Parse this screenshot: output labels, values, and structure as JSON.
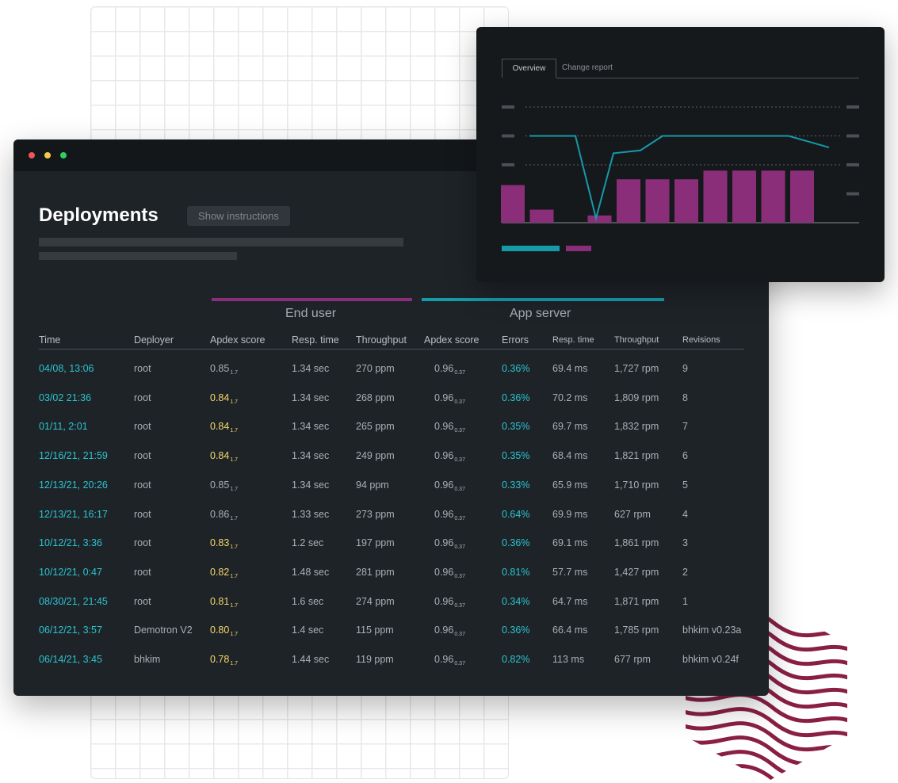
{
  "page": {
    "title": "Deployments",
    "show_instructions_label": "Show instructions"
  },
  "colors": {
    "end_user": "#8b2e7a",
    "app_server": "#159aa9",
    "time_link": "#2bc4cf",
    "apdex_warning": "#f6d66a",
    "chart_bar": "#8b2e7a",
    "chart_line": "#159aa9"
  },
  "groups": {
    "end_user": "End user",
    "app_server": "App server"
  },
  "columns": {
    "time": "Time",
    "deployer": "Deployer",
    "eu_apdex": "Apdex score",
    "eu_resp": "Resp. time",
    "eu_throughput": "Throughput",
    "as_apdex": "Apdex score",
    "as_errors": "Errors",
    "as_resp": "Resp. time",
    "as_throughput": "Throughput",
    "revisions": "Revisions"
  },
  "rows": [
    {
      "time": "04/08, 13:06",
      "deployer": "root",
      "eu_apdex": "0.85",
      "eu_apdex_sub": "1.7",
      "eu_apdex_warn": false,
      "eu_resp": "1.34 sec",
      "eu_throughput": "270 ppm",
      "as_apdex": "0.96",
      "as_apdex_sub": "0.37",
      "as_errors": "0.36%",
      "as_resp": "69.4 ms",
      "as_throughput": "1,727 rpm",
      "revision": "9"
    },
    {
      "time": "03/02 21:36",
      "deployer": "root",
      "eu_apdex": "0.84",
      "eu_apdex_sub": "1.7",
      "eu_apdex_warn": true,
      "eu_resp": "1.34 sec",
      "eu_throughput": "268 ppm",
      "as_apdex": "0.96",
      "as_apdex_sub": "0.37",
      "as_errors": "0.36%",
      "as_resp": "70.2 ms",
      "as_throughput": "1,809 rpm",
      "revision": "8"
    },
    {
      "time": "01/11, 2:01",
      "deployer": "root",
      "eu_apdex": "0.84",
      "eu_apdex_sub": "1.7",
      "eu_apdex_warn": true,
      "eu_resp": "1.34 sec",
      "eu_throughput": "265 ppm",
      "as_apdex": "0.96",
      "as_apdex_sub": "0.37",
      "as_errors": "0.35%",
      "as_resp": "69.7 ms",
      "as_throughput": "1,832 rpm",
      "revision": "7"
    },
    {
      "time": "12/16/21, 21:59",
      "deployer": "root",
      "eu_apdex": "0.84",
      "eu_apdex_sub": "1.7",
      "eu_apdex_warn": true,
      "eu_resp": "1.34 sec",
      "eu_throughput": "249 ppm",
      "as_apdex": "0.96",
      "as_apdex_sub": "0.37",
      "as_errors": "0.35%",
      "as_resp": "68.4 ms",
      "as_throughput": "1,821 rpm",
      "revision": "6"
    },
    {
      "time": "12/13/21, 20:26",
      "deployer": "root",
      "eu_apdex": "0.85",
      "eu_apdex_sub": "1.7",
      "eu_apdex_warn": false,
      "eu_resp": "1.34 sec",
      "eu_throughput": "94 ppm",
      "as_apdex": "0.96",
      "as_apdex_sub": "0.37",
      "as_errors": "0.33%",
      "as_resp": "65.9 ms",
      "as_throughput": "1,710 rpm",
      "revision": "5"
    },
    {
      "time": "12/13/21, 16:17",
      "deployer": "root",
      "eu_apdex": "0.86",
      "eu_apdex_sub": "1.7",
      "eu_apdex_warn": false,
      "eu_resp": "1.33 sec",
      "eu_throughput": "273 ppm",
      "as_apdex": "0.96",
      "as_apdex_sub": "0.37",
      "as_errors": "0.64%",
      "as_resp": "69.9 ms",
      "as_throughput": "627 rpm",
      "revision": "4"
    },
    {
      "time": "10/12/21, 3:36",
      "deployer": "root",
      "eu_apdex": "0.83",
      "eu_apdex_sub": "1.7",
      "eu_apdex_warn": true,
      "eu_resp": "1.2 sec",
      "eu_throughput": "197 ppm",
      "as_apdex": "0.96",
      "as_apdex_sub": "0.37",
      "as_errors": "0.36%",
      "as_resp": "69.1 ms",
      "as_throughput": "1,861 rpm",
      "revision": "3"
    },
    {
      "time": "10/12/21, 0:47",
      "deployer": "root",
      "eu_apdex": "0.82",
      "eu_apdex_sub": "1.7",
      "eu_apdex_warn": true,
      "eu_resp": "1.48 sec",
      "eu_throughput": "281 ppm",
      "as_apdex": "0.96",
      "as_apdex_sub": "0.37",
      "as_errors": "0.81%",
      "as_resp": "57.7 ms",
      "as_throughput": "1,427 rpm",
      "revision": "2"
    },
    {
      "time": "08/30/21, 21:45",
      "deployer": "root",
      "eu_apdex": "0.81",
      "eu_apdex_sub": "1.7",
      "eu_apdex_warn": true,
      "eu_resp": "1.6 sec",
      "eu_throughput": "274 ppm",
      "as_apdex": "0.96",
      "as_apdex_sub": "0.37",
      "as_errors": "0.34%",
      "as_resp": "64.7 ms",
      "as_throughput": "1,871 rpm",
      "revision": "1"
    },
    {
      "time": "06/12/21, 3:57",
      "deployer": "Demotron V2",
      "eu_apdex": "0.80",
      "eu_apdex_sub": "1.7",
      "eu_apdex_warn": true,
      "eu_resp": "1.4 sec",
      "eu_throughput": "115 ppm",
      "as_apdex": "0.96",
      "as_apdex_sub": "0.37",
      "as_errors": "0.36%",
      "as_resp": "66.4 ms",
      "as_throughput": "1,785 rpm",
      "revision": "bhkim v0.23a"
    },
    {
      "time": "06/14/21, 3:45",
      "deployer": "bhkim",
      "eu_apdex": "0.78",
      "eu_apdex_sub": "1.7",
      "eu_apdex_warn": true,
      "eu_resp": "1.44 sec",
      "eu_throughput": "119 ppm",
      "as_apdex": "0.96",
      "as_apdex_sub": "0.37",
      "as_errors": "0.82%",
      "as_resp": "113 ms",
      "as_throughput": "677 rpm",
      "revision": "bhkim v0.24f"
    }
  ],
  "chart_panel": {
    "tabs": [
      "Overview",
      "Change report"
    ],
    "active_tab": "Overview"
  },
  "chart_data": {
    "type": "bar",
    "ylim": [
      0,
      4
    ],
    "grid": true,
    "legend": "bottom-left",
    "series": [
      {
        "type": "bar",
        "values": [
          1.3,
          0.45,
          0,
          0.25,
          1.5,
          1.5,
          1.5,
          1.8,
          1.8,
          1.8,
          1.8
        ]
      },
      {
        "type": "line",
        "values": [
          3.0,
          3.0,
          3.0,
          0.15,
          2.4,
          2.5,
          3.0,
          3.0,
          3.0,
          3.0,
          3.0,
          2.6
        ]
      }
    ]
  }
}
